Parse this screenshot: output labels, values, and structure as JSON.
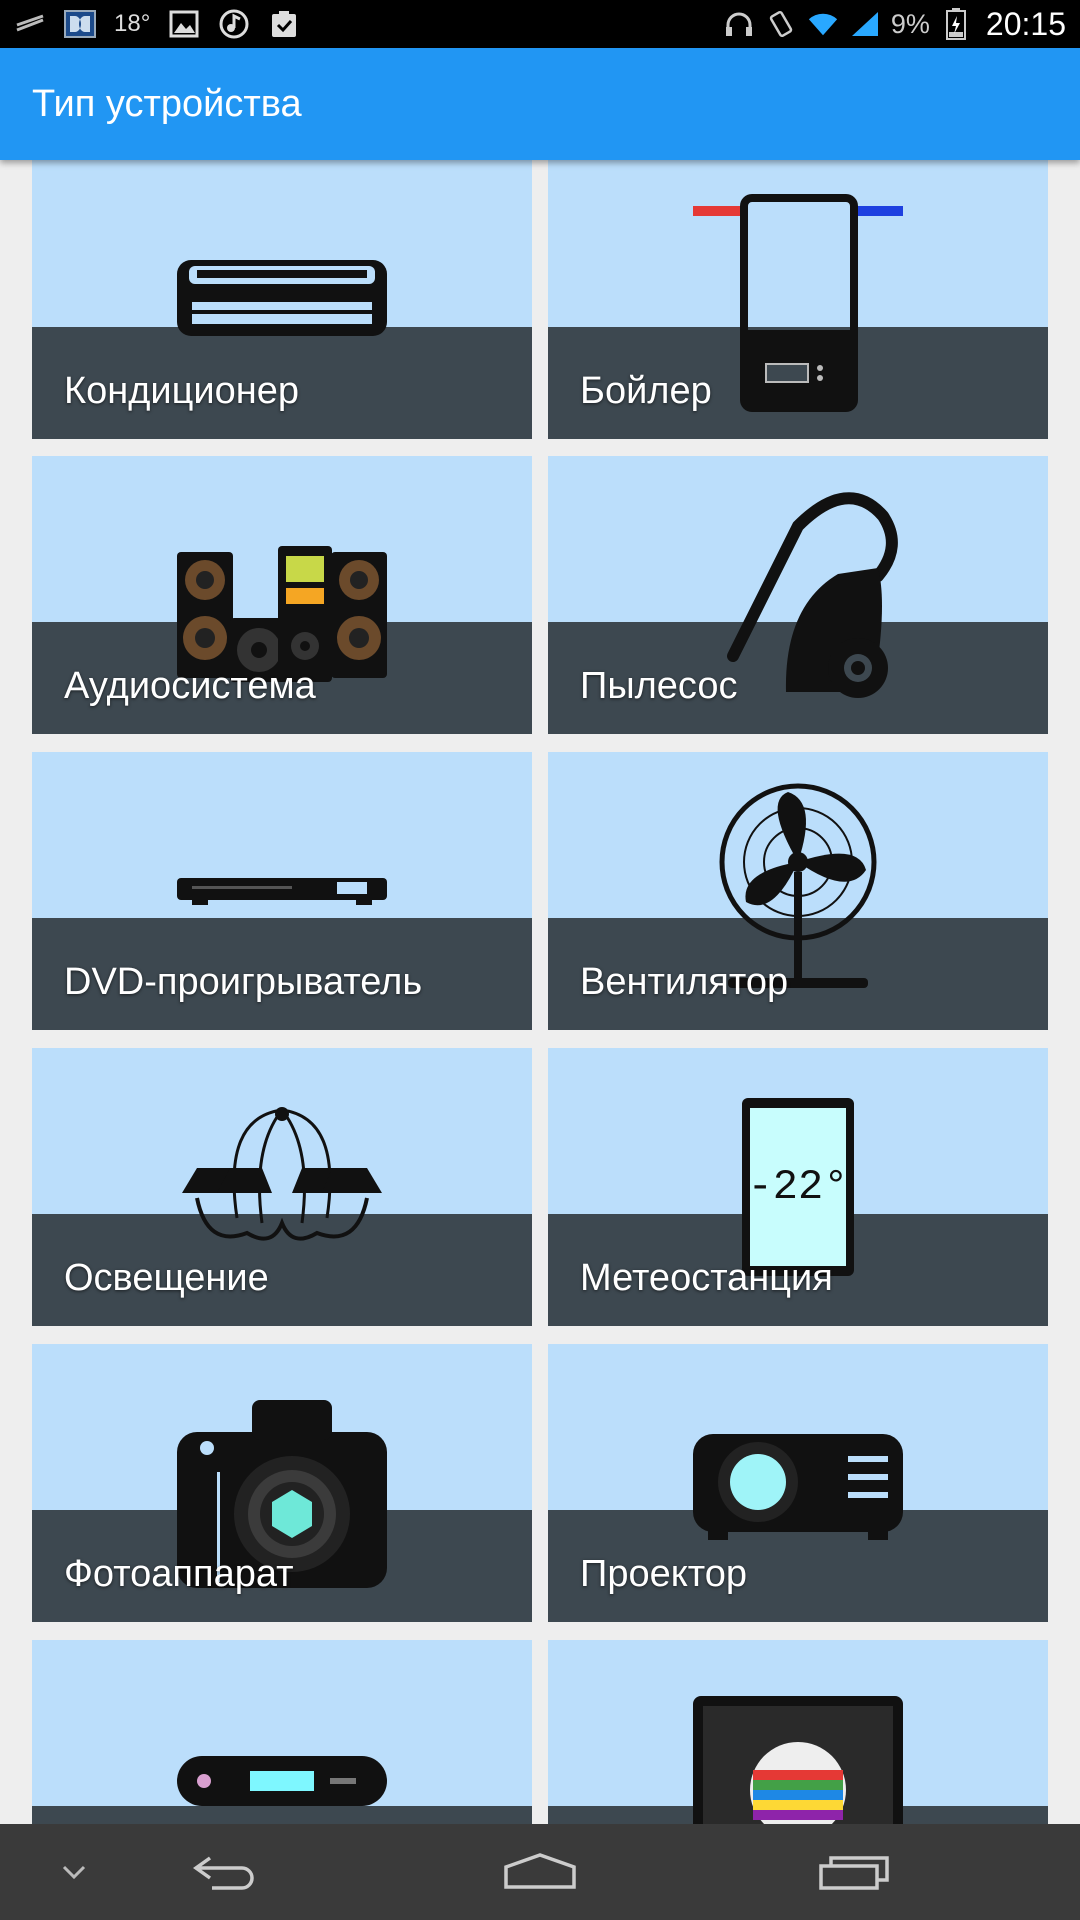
{
  "status_bar": {
    "temperature": "18°",
    "battery": "9%",
    "time": "20:15"
  },
  "app_bar": {
    "title": "Тип устройства"
  },
  "devices": [
    {
      "label": "Кондиционер",
      "icon": "air-conditioner-icon"
    },
    {
      "label": "Бойлер",
      "icon": "boiler-icon"
    },
    {
      "label": "Аудиосистема",
      "icon": "audio-system-icon"
    },
    {
      "label": "Пылесос",
      "icon": "vacuum-cleaner-icon"
    },
    {
      "label": "DVD-проигрыватель",
      "icon": "dvd-player-icon"
    },
    {
      "label": "Вентилятор",
      "icon": "fan-icon"
    },
    {
      "label": "Освещение",
      "icon": "chandelier-icon"
    },
    {
      "label": "Метеостанция",
      "icon": "weather-station-icon",
      "display_text": "-22°"
    },
    {
      "label": "Фотоаппарат",
      "icon": "camera-icon"
    },
    {
      "label": "Проектор",
      "icon": "projector-icon"
    },
    {
      "label": "",
      "icon": "set-top-box-icon"
    },
    {
      "label": "",
      "icon": "tv-test-pattern-icon"
    }
  ],
  "colors": {
    "app_bar": "#2196f3",
    "tile_background": "#bbdefb",
    "tile_band": "#3d4850",
    "nav_bar": "#3a3a3a"
  }
}
